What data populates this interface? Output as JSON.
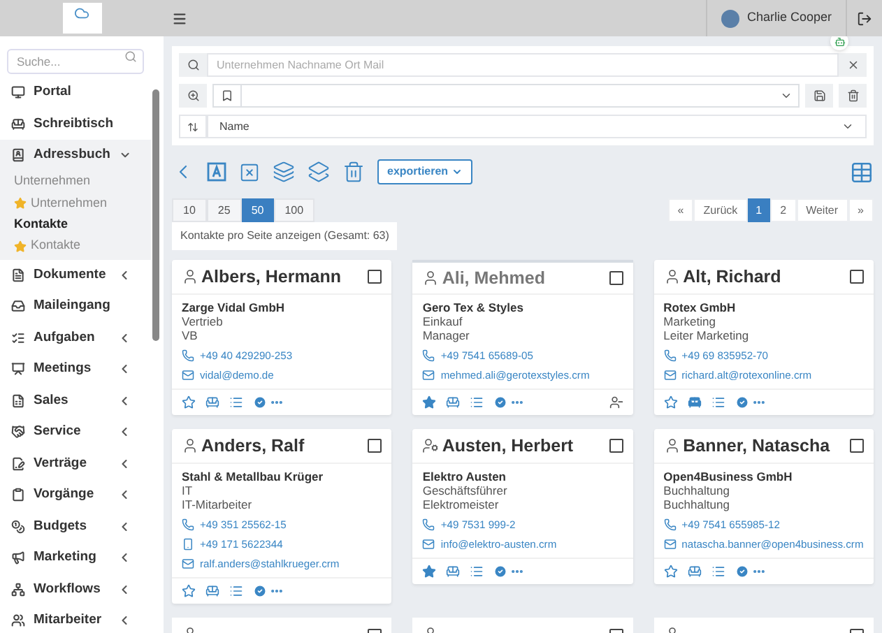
{
  "header": {
    "user_name": "Charlie Cooper"
  },
  "sidebar": {
    "search_placeholder": "Suche...",
    "items": [
      {
        "label": "Portal",
        "has_submenu": false,
        "expanded": false
      },
      {
        "label": "Schreibtisch",
        "has_submenu": false,
        "expanded": false
      },
      {
        "label": "Adressbuch",
        "has_submenu": true,
        "expanded": true,
        "children": [
          {
            "label": "Unternehmen",
            "favorite": false,
            "selected": false
          },
          {
            "label": "Unternehmen",
            "favorite": true,
            "selected": false
          },
          {
            "label": "Kontakte",
            "favorite": false,
            "selected": true
          },
          {
            "label": "Kontakte",
            "favorite": true,
            "selected": false
          }
        ]
      },
      {
        "label": "Dokumente",
        "has_submenu": true,
        "expanded": false
      },
      {
        "label": "Maileingang",
        "has_submenu": false,
        "expanded": false
      },
      {
        "label": "Aufgaben",
        "has_submenu": true,
        "expanded": false
      },
      {
        "label": "Meetings",
        "has_submenu": true,
        "expanded": false
      },
      {
        "label": "Sales",
        "has_submenu": true,
        "expanded": false
      },
      {
        "label": "Service",
        "has_submenu": true,
        "expanded": false
      },
      {
        "label": "Verträge",
        "has_submenu": true,
        "expanded": false
      },
      {
        "label": "Vorgänge",
        "has_submenu": true,
        "expanded": false
      },
      {
        "label": "Budgets",
        "has_submenu": true,
        "expanded": false
      },
      {
        "label": "Marketing",
        "has_submenu": true,
        "expanded": false
      },
      {
        "label": "Workflows",
        "has_submenu": true,
        "expanded": false
      },
      {
        "label": "Mitarbeiter",
        "has_submenu": true,
        "expanded": false
      }
    ]
  },
  "filters": {
    "search_placeholder": "Unternehmen Nachname Ort Mail",
    "sort_value": "Name"
  },
  "toolbar": {
    "export_button": "exportieren"
  },
  "page_sizes": [
    {
      "label": "10",
      "selected": false
    },
    {
      "label": "25",
      "selected": false
    },
    {
      "label": "50",
      "selected": true
    },
    {
      "label": "100",
      "selected": false
    }
  ],
  "page_size_info": "Kontakte pro Seite anzeigen (Gesamt: 63)",
  "pagination": [
    {
      "label": "«",
      "selected": false
    },
    {
      "label": "Zurück",
      "selected": false
    },
    {
      "label": "1",
      "selected": true
    },
    {
      "label": "2",
      "selected": false
    },
    {
      "label": "Weiter",
      "selected": false
    },
    {
      "label": "»",
      "selected": false
    }
  ],
  "cards": [
    {
      "name": "Albers, Hermann",
      "kind": "person",
      "dimmed": false,
      "checked": false,
      "company": "Zarge Vidal GmbH",
      "department": "Vertrieb",
      "position": "VB",
      "contacts": [
        {
          "kind": "phone",
          "text": "+49 40 429290-253"
        },
        {
          "kind": "email",
          "text": "vidal@demo.de"
        }
      ],
      "favorite": false,
      "desk_active": false,
      "unlinked": false
    },
    {
      "name": "Ali, Mehmed",
      "kind": "person",
      "dimmed": true,
      "checked": false,
      "company": "Gero Tex & Styles",
      "department": "Einkauf",
      "position": "Manager",
      "contacts": [
        {
          "kind": "phone",
          "text": "+49 7541 65689-05"
        },
        {
          "kind": "email",
          "text": "mehmed.ali@gerotexstyles.crm"
        }
      ],
      "favorite": true,
      "desk_active": false,
      "unlinked": true
    },
    {
      "name": "Alt, Richard",
      "kind": "person",
      "dimmed": false,
      "checked": false,
      "company": "Rotex GmbH",
      "department": "Marketing",
      "position": "Leiter Marketing",
      "contacts": [
        {
          "kind": "phone",
          "text": "+49 69 835952-70"
        },
        {
          "kind": "email",
          "text": "richard.alt@rotexonline.crm"
        }
      ],
      "favorite": false,
      "desk_active": true,
      "unlinked": false
    },
    {
      "name": "Anders, Ralf",
      "kind": "person",
      "dimmed": false,
      "checked": false,
      "company": "Stahl & Metallbau Krüger",
      "department": "IT",
      "position": "IT-Mitarbeiter",
      "contacts": [
        {
          "kind": "phone",
          "text": "+49 351 25562-15"
        },
        {
          "kind": "mobile",
          "text": "+49 171 5622344"
        },
        {
          "kind": "email",
          "text": "ralf.anders@stahlkrueger.crm"
        }
      ],
      "favorite": false,
      "desk_active": false,
      "unlinked": false
    },
    {
      "name": "Austen, Herbert",
      "kind": "person-gear",
      "dimmed": false,
      "checked": false,
      "company": "Elektro Austen",
      "department": "Geschäftsführer",
      "position": "Elektromeister",
      "contacts": [
        {
          "kind": "phone",
          "text": "+49 7531 999-2"
        },
        {
          "kind": "email",
          "text": "info@elektro-austen.crm"
        }
      ],
      "favorite": true,
      "desk_active": false,
      "unlinked": false
    },
    {
      "name": "Banner, Natascha",
      "kind": "person",
      "dimmed": false,
      "checked": false,
      "company": "Open4Business GmbH",
      "department": "Buchhaltung",
      "position": "Buchhaltung",
      "contacts": [
        {
          "kind": "phone",
          "text": "+49 7541 655985-12"
        },
        {
          "kind": "email",
          "text": "natascha.banner@open4business.crm"
        }
      ],
      "favorite": false,
      "desk_active": false,
      "unlinked": false
    }
  ],
  "cut_off_cards": [
    {
      "checked": false
    },
    {
      "checked": false
    },
    {
      "checked": false
    }
  ]
}
